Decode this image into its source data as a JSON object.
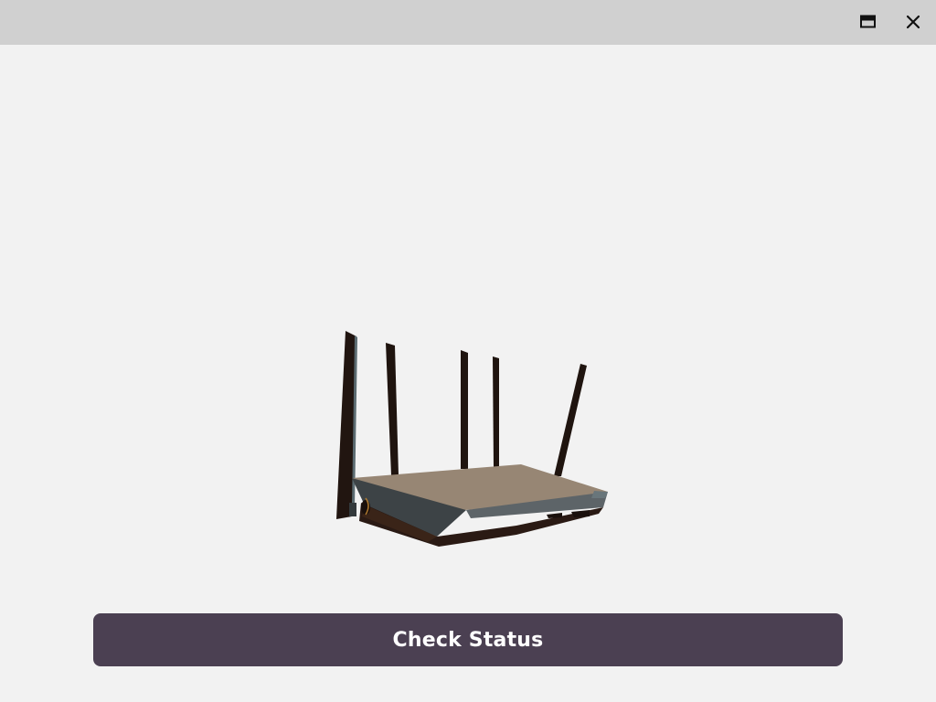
{
  "window": {
    "controls": {
      "restore_icon": "restore-window-icon",
      "close_icon": "close-icon"
    }
  },
  "main": {
    "illustration_icon": "wifi-router-illustration",
    "action_button_label": "Check Status"
  },
  "colors": {
    "titlebar": "#d0d0d0",
    "background": "#f2f2f2",
    "button": "#4b4052",
    "button_text": "#ffffff"
  }
}
